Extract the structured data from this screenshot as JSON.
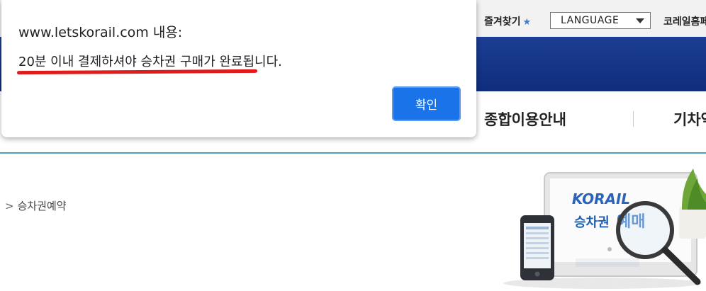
{
  "header": {
    "bookmark_label": "즐겨찾기",
    "bookmark_star": "★",
    "language_select": {
      "selected": "LANGUAGE"
    },
    "home_link": "코레일홈페"
  },
  "nav": {
    "items": [
      {
        "label": "종합이용안내"
      },
      {
        "label": "기차역"
      }
    ]
  },
  "breadcrumb": {
    "chevron": ">",
    "label": "승차권예약"
  },
  "banner": {
    "logo_text": "KORAIL",
    "caption_prefix": "승차권 ",
    "caption_highlight": "예매"
  },
  "dialog": {
    "title": "www.letskorail.com 내용:",
    "message": "20분 이내 결제하셔야 승차권 구매가 완료됩니다.",
    "ok_label": "확인"
  },
  "colors": {
    "brand_blue": "#1c3e93",
    "button_blue": "#1a73e8",
    "annotation_red": "#e01b1b",
    "nav_line": "#4aa0bc"
  }
}
